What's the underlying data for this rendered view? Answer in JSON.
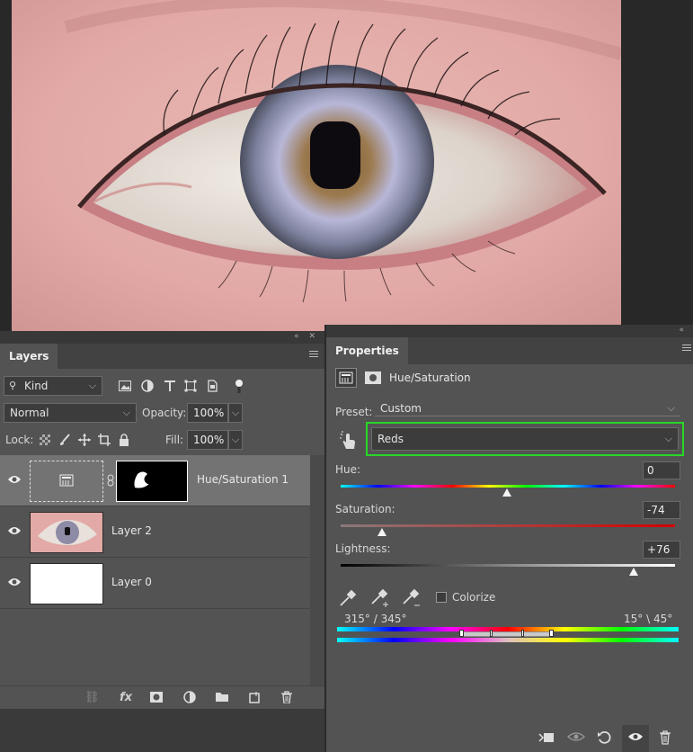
{
  "layers_panel": {
    "tab_label": "Layers",
    "filter_kind": "Kind",
    "blend_mode": "Normal",
    "opacity_label": "Opacity:",
    "opacity_value": "100%",
    "lock_label": "Lock:",
    "fill_label": "Fill:",
    "fill_value": "100%",
    "layers": [
      {
        "name": "Hue/Saturation 1",
        "selected": true
      },
      {
        "name": "Layer 2",
        "selected": false
      },
      {
        "name": "Layer 0",
        "selected": false
      }
    ]
  },
  "properties_panel": {
    "tab_label": "Properties",
    "title": "Hue/Saturation",
    "preset_label": "Preset:",
    "preset_value": "Custom",
    "channel_value": "Reds",
    "hue_label": "Hue:",
    "hue_value": "0",
    "saturation_label": "Saturation:",
    "saturation_value": "-74",
    "lightness_label": "Lightness:",
    "lightness_value": "+76",
    "colorize_label": "Colorize",
    "range_left": "315° / 345°",
    "range_right": "15° \\ 45°"
  },
  "colors": {
    "panel_bg": "#535353",
    "highlight_green": "#28d728",
    "selected_layer": "#737373"
  }
}
